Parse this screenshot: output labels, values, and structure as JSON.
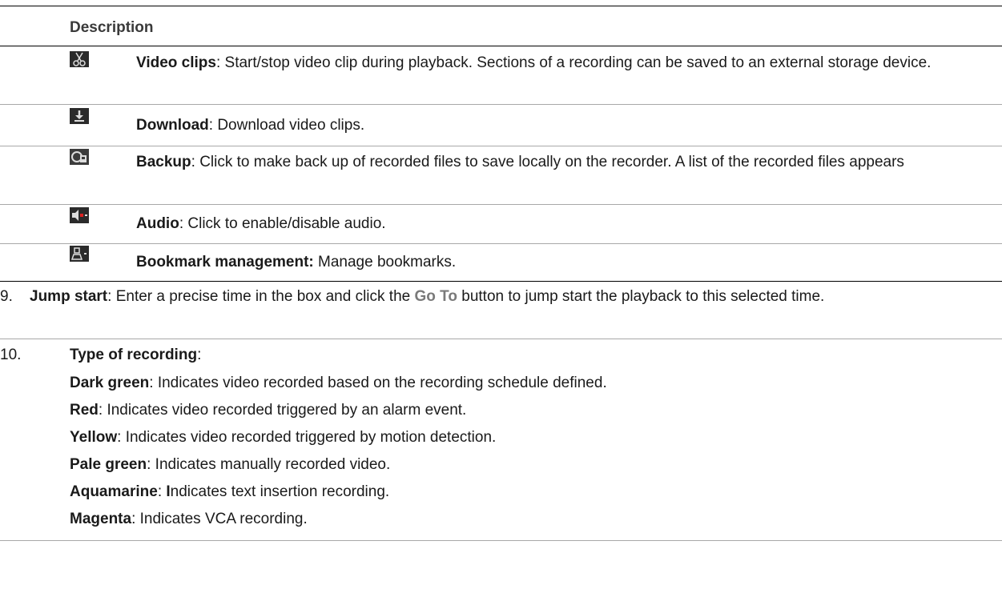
{
  "table": {
    "header": "Description",
    "rows": [
      {
        "icon": "scissors-icon",
        "title": "Video clips",
        "text": ": Start/stop video clip during playback. Sections of a recording can be saved to an external storage device."
      },
      {
        "icon": "download-icon",
        "title": "Download",
        "text": ": Download video clips."
      },
      {
        "icon": "backup-icon",
        "title": "Backup",
        "text": ": Click to make back up of recorded files to save locally on the recorder. A list of the recorded files appears"
      },
      {
        "icon": "audio-icon",
        "title": "Audio",
        "text": ": Click to enable/disable audio."
      },
      {
        "icon": "bookmark-icon",
        "title": "Bookmark management:",
        "text": " Manage bookmarks."
      }
    ]
  },
  "items": [
    {
      "number": "9.",
      "title": "Jump start",
      "text_before": ": Enter a precise time in the box and click the ",
      "button": "Go To",
      "text_after": " button to jump start the playback to this selected time."
    },
    {
      "number": "10.",
      "title": "Type of recording",
      "colon": ":",
      "colors": [
        {
          "name": "Dark green",
          "text": ": Indicates video recorded based on the recording schedule defined."
        },
        {
          "name": "Red",
          "text": ": Indicates video recorded triggered by an alarm event."
        },
        {
          "name": "Yellow",
          "text": ": Indicates video recorded triggered by motion detection."
        },
        {
          "name": "Pale green",
          "text": ": Indicates manually recorded video."
        },
        {
          "name": "Aquamarine",
          "bold_initial": "I",
          "text": "ndicates text insertion recording.",
          "sep": ": "
        },
        {
          "name": "Magenta",
          "text": ": Indicates VCA recording."
        }
      ]
    }
  ]
}
